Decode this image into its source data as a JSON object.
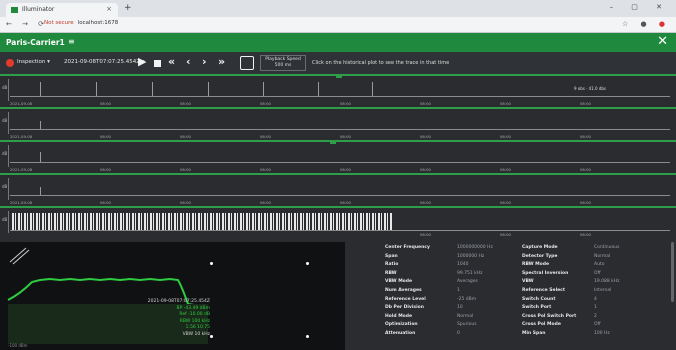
{
  "browser": {
    "tab_title": "Illuminator",
    "new_tab": "+",
    "url_warning": "Not secure",
    "url": "localhost:1678",
    "window_controls": "– ▢ ✕"
  },
  "app": {
    "title": "Paris-Carrier1",
    "menu_icon": "≡",
    "close": "✕"
  },
  "toolbar": {
    "mode": "Inspection",
    "timestamp": "2021-09-08T07:07:25.454Z",
    "playback_label": "Playback Speed",
    "playback_value": "500 ms",
    "hint": "Click on the historical plot to see the trace in that time"
  },
  "traces": {
    "x_ticks": [
      "2021-09-08",
      "06:00",
      "06:00",
      "06:00",
      "06:00",
      "06:00",
      "06:00",
      "06:00",
      "06:00"
    ],
    "note": "9 obs · 41.0 dbs",
    "y_labels": [
      "dB",
      "dB",
      "dB",
      "dB",
      "dB"
    ]
  },
  "spectrum": {
    "timestamp": "2021-09-08T07:07:25.454Z",
    "band_power": "BP -43.49 dBm",
    "ref": "Ref -10.00 dB",
    "rbw": "RBW 100 kHz",
    "ratio": "1.56 10.75",
    "res": "VBW 10 kHz",
    "freq_min": "-100 dBm",
    "trace_color": "#2ecc40"
  },
  "settings": [
    {
      "k1": "Center Frequency",
      "v1": "1000000000 Hz",
      "k2": "Capture Mode",
      "v2": "Continuous"
    },
    {
      "k1": "Span",
      "v1": "1000000 Hz",
      "k2": "Detector Type",
      "v2": "Normal"
    },
    {
      "k1": "Ratio",
      "v1": "1040",
      "k2": "RBW Mode",
      "v2": "Auto"
    },
    {
      "k1": "RBW",
      "v1": "99.751 kHz",
      "k2": "Spectral Inversion",
      "v2": "Off"
    },
    {
      "k1": "VBW Mode",
      "v1": "Averages",
      "k2": "VBW",
      "v2": "19.088 kHz"
    },
    {
      "k1": "Num Averages",
      "v1": "1",
      "k2": "Reference Select",
      "v2": "Internal"
    },
    {
      "k1": "Reference Level",
      "v1": "-25 dBm",
      "k2": "Switch Count",
      "v2": "4"
    },
    {
      "k1": "Db Per Division",
      "v1": "10",
      "k2": "Switch Port",
      "v2": "1"
    },
    {
      "k1": "Hold Mode",
      "v1": "Normal",
      "k2": "Cross Pol Switch Port",
      "v2": "2"
    },
    {
      "k1": "Optimization",
      "v1": "Spurious",
      "k2": "Cross Pol Mode",
      "v2": "Off"
    },
    {
      "k1": "Attenuation",
      "v1": "0",
      "k2": "Min Span",
      "v2": "100 Hz"
    }
  ],
  "colors": {
    "accent": "#1f8a3d",
    "panel": "#2a2c30"
  }
}
